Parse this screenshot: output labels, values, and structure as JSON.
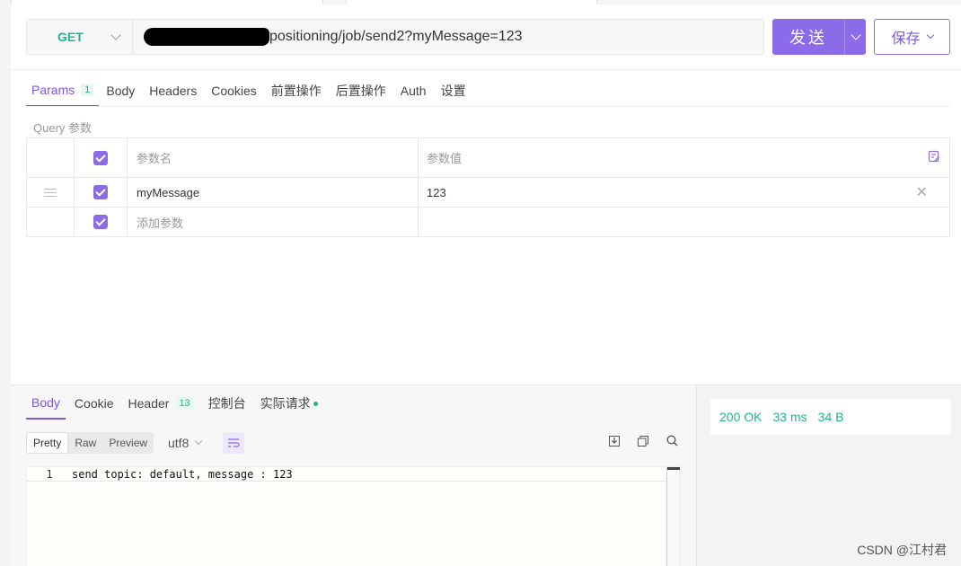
{
  "request": {
    "method": "GET",
    "url_visible": "positioning/job/send2?myMessage=123",
    "send_label": "发送",
    "save_label": "保存"
  },
  "req_tabs": [
    {
      "label": "Params",
      "badge": "1"
    },
    {
      "label": "Body"
    },
    {
      "label": "Headers"
    },
    {
      "label": "Cookies"
    },
    {
      "label": "前置操作"
    },
    {
      "label": "后置操作"
    },
    {
      "label": "Auth"
    },
    {
      "label": "设置"
    }
  ],
  "params": {
    "section_label": "Query 参数",
    "header_name": "参数名",
    "header_value": "参数值",
    "rows": [
      {
        "name": "myMessage",
        "value": "123"
      }
    ],
    "add_placeholder": "添加参数"
  },
  "response": {
    "tabs": [
      {
        "label": "Body"
      },
      {
        "label": "Cookie"
      },
      {
        "label": "Header",
        "badge": "13"
      },
      {
        "label": "控制台"
      },
      {
        "label": "实际请求"
      }
    ],
    "formats": [
      "Pretty",
      "Raw",
      "Preview"
    ],
    "encoding": "utf8",
    "lines": [
      {
        "no": "1",
        "text": "send topic: default, message : 123"
      }
    ],
    "status": {
      "code": "200 OK",
      "time": "33 ms",
      "size": "34 B"
    }
  },
  "watermark": "CSDN @江村君",
  "colors": {
    "accent": "#8b6be8",
    "success": "#1fb58a"
  }
}
